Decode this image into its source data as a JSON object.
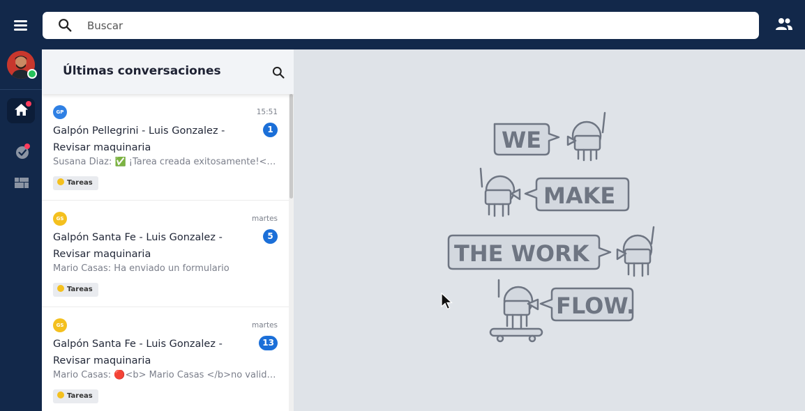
{
  "search": {
    "placeholder": "Buscar"
  },
  "panel": {
    "title": "Últimas conversaciones"
  },
  "conversations": [
    {
      "initials": "GP",
      "chip_color": "#2f80e4",
      "time": "15:51",
      "title": "Galpón Pellegrini - Luis Gonzalez - Revisar maquinaria",
      "unread": "1",
      "preview": "Susana Diaz: ✅ ¡Tarea creada exitosamente!<br>...",
      "tag": "Tareas"
    },
    {
      "initials": "GS",
      "chip_color": "#f4c01e",
      "time": "martes",
      "title": "Galpón Santa Fe - Luis Gonzalez - Revisar maquinaria",
      "unread": "5",
      "preview": "Mario Casas: Ha enviado un formulario",
      "tag": "Tareas"
    },
    {
      "initials": "GS",
      "chip_color": "#f4c01e",
      "time": "martes",
      "title": "Galpón Santa Fe - Luis Gonzalez - Revisar maquinaria",
      "unread": "13",
      "preview": "Mario Casas: 🔴<b> Mario Casas </b>no validó ...",
      "tag": "Tareas"
    }
  ],
  "illustration": {
    "line1": "WE",
    "line2": "MAKE",
    "line3": "THE WORK",
    "line4": "FLOW."
  },
  "colors": {
    "navy": "#12284a",
    "accent_blue": "#1b6fd8",
    "tag_yellow": "#f4c01e",
    "online_green": "#27c15a",
    "notification_red": "#ff3b5c"
  },
  "icons": [
    "menu-icon",
    "search-icon",
    "people-icon",
    "home-icon",
    "task-check-icon",
    "board-icon"
  ]
}
